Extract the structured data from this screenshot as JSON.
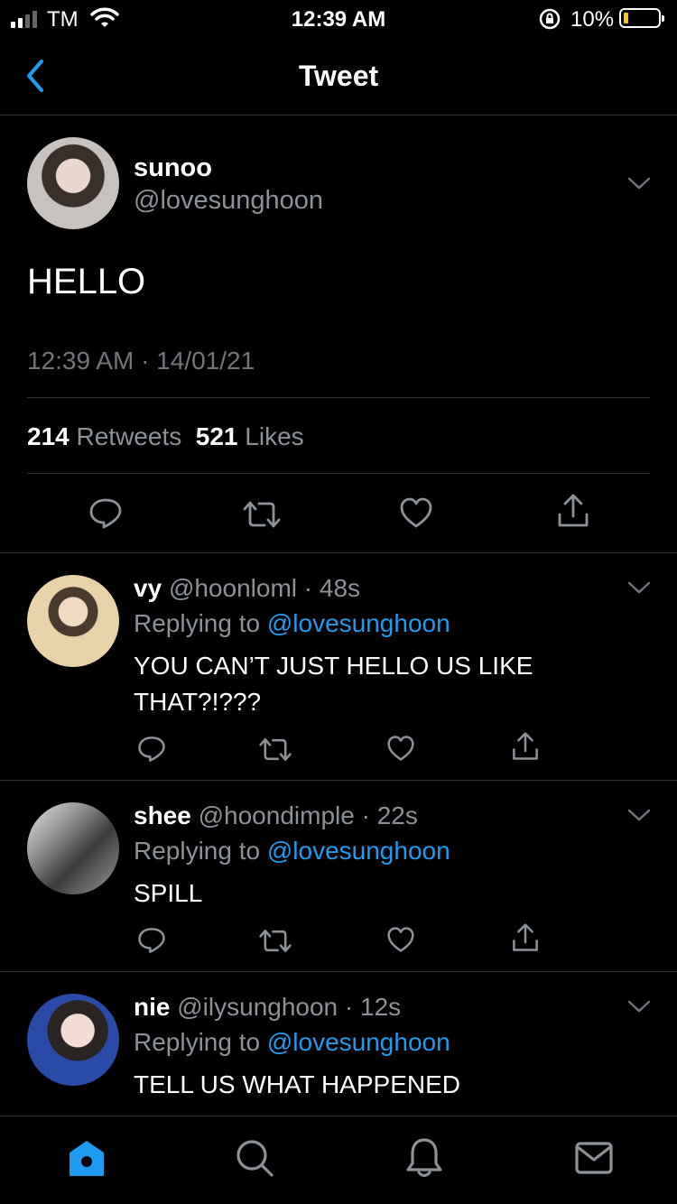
{
  "status_bar": {
    "carrier": "TM",
    "time": "12:39 AM",
    "battery": "10%"
  },
  "nav": {
    "title": "Tweet"
  },
  "main_tweet": {
    "name": "sunoo",
    "handle": "@lovesunghoon",
    "text": "HELLO",
    "timestamp": "12:39 AM · 14/01/21",
    "retweets_count": "214",
    "retweets_label": "Retweets",
    "likes_count": "521",
    "likes_label": "Likes"
  },
  "replies": [
    {
      "name": "vy",
      "handle": "@hoonloml",
      "age": "· 48s",
      "replying_label": "Replying to",
      "replying_to": "@lovesunghoon",
      "text": "YOU CAN’T JUST HELLO US LIKE THAT?!???"
    },
    {
      "name": "shee",
      "handle": "@hoondimple",
      "age": "· 22s",
      "replying_label": "Replying to",
      "replying_to": "@lovesunghoon",
      "text": "SPILL"
    },
    {
      "name": "nie",
      "handle": "@ilysunghoon",
      "age": "· 12s",
      "replying_label": "Replying to",
      "replying_to": "@lovesunghoon",
      "text": "TELL US WHAT HAPPENED"
    }
  ],
  "colors": {
    "background": "#000000",
    "accent": "#1d9bf0",
    "muted": "#8b9298",
    "divider": "#2f3336"
  },
  "icons": [
    "reply-icon",
    "retweet-icon",
    "like-icon",
    "share-icon",
    "home-icon",
    "search-icon",
    "notifications-icon",
    "messages-icon"
  ]
}
